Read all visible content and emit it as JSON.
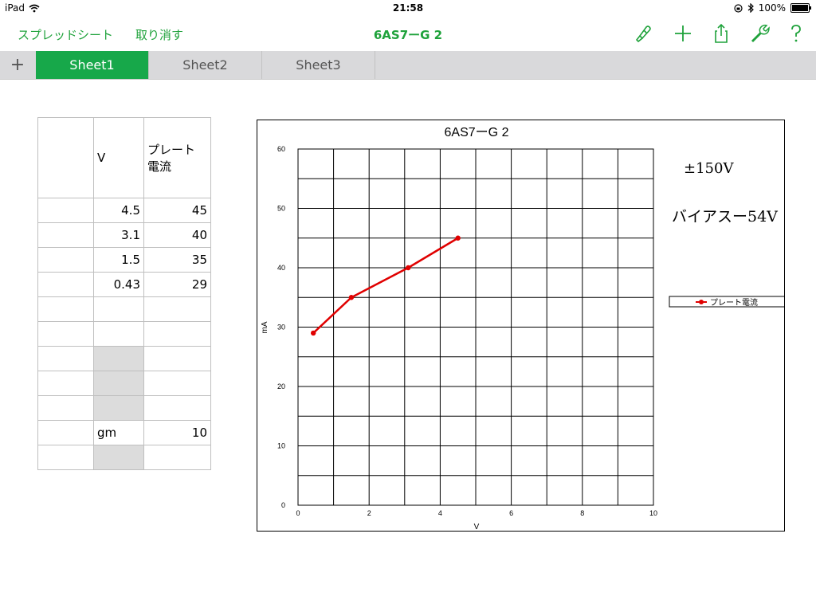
{
  "status": {
    "device": "iPad",
    "time": "21:58",
    "battery": "100%"
  },
  "toolbar": {
    "back_label": "スプレッドシート",
    "undo_label": "取り消す",
    "title": "6AS7ーG 2"
  },
  "tabs": [
    {
      "label": "Sheet1"
    },
    {
      "label": "Sheet2"
    },
    {
      "label": "Sheet3"
    }
  ],
  "table": {
    "header": {
      "col1": "V",
      "col2_line1": "プレート",
      "col2_line2": "電流"
    },
    "rows": [
      {
        "v": "4.5",
        "i": "45"
      },
      {
        "v": "3.1",
        "i": "40"
      },
      {
        "v": "1.5",
        "i": "35"
      },
      {
        "v": "0.43",
        "i": "29"
      }
    ],
    "gm_label": "gm",
    "gm_value": "10"
  },
  "annotations": {
    "voltage": "±150V",
    "bias": "バイアスー54V"
  },
  "colors": {
    "accent": "#1fa23b",
    "tab_active": "#17a84a",
    "series": "#e00000"
  },
  "chart_data": {
    "type": "line",
    "title": "6AS7ーG  2",
    "xlabel": "V",
    "ylabel": "mA",
    "xlim": [
      0,
      10
    ],
    "ylim": [
      0,
      60
    ],
    "xticks": [
      0,
      2,
      4,
      6,
      8,
      10
    ],
    "yticks": [
      0,
      10,
      20,
      30,
      40,
      50,
      60
    ],
    "grid": true,
    "legend_position": "right",
    "series": [
      {
        "name": "プレート電流",
        "x": [
          0.43,
          1.5,
          3.1,
          4.5
        ],
        "y": [
          29,
          35,
          40,
          45
        ]
      }
    ]
  }
}
